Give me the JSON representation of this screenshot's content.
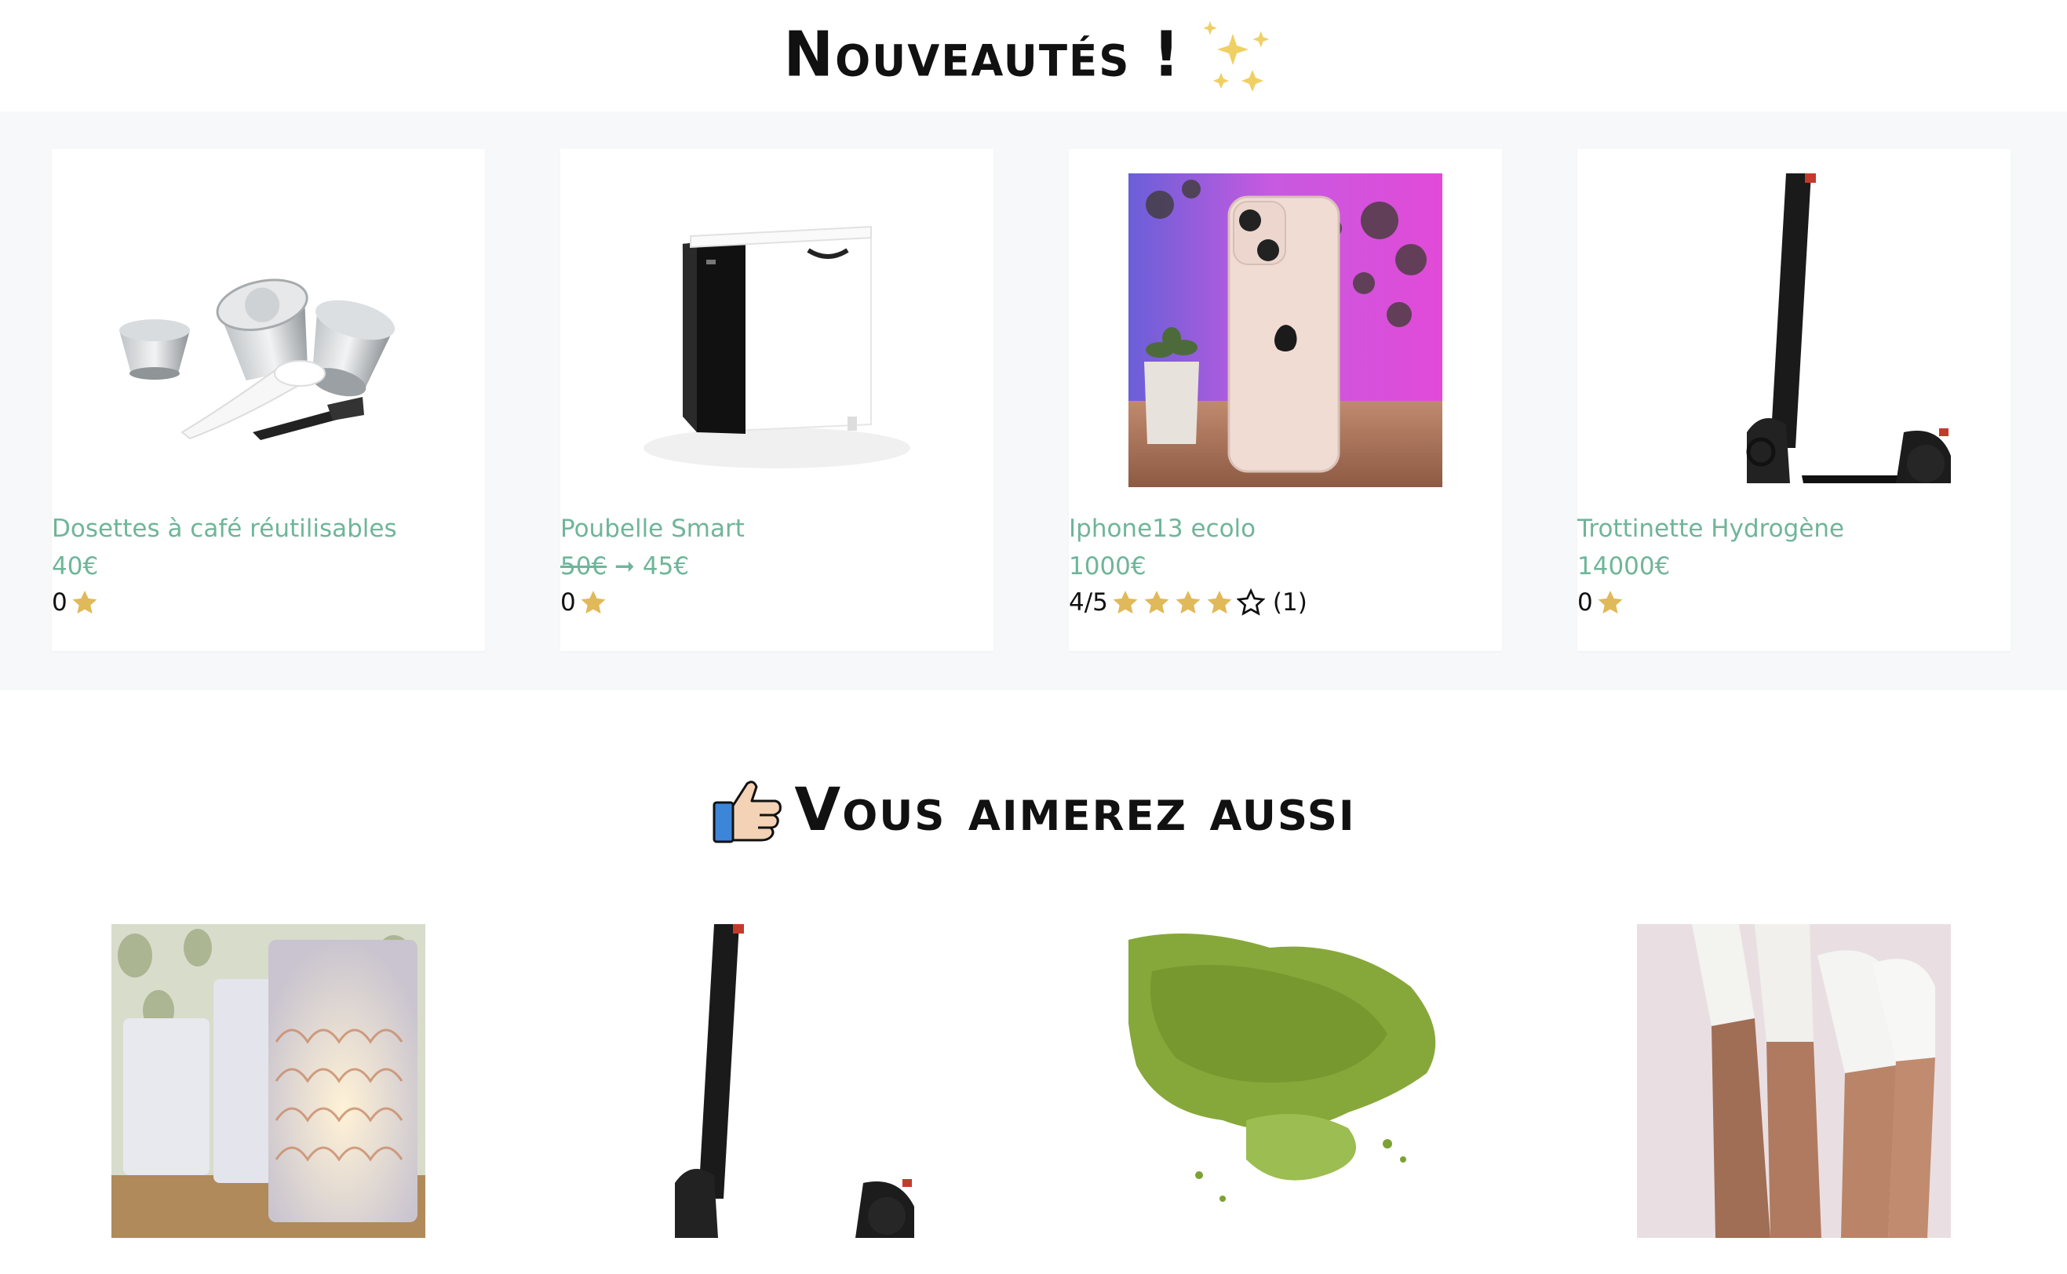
{
  "sections": {
    "new": {
      "title": "Nouveautés !"
    },
    "also": {
      "title": "Vous aimerez aussi"
    }
  },
  "new_products": [
    {
      "name": "Dosettes à café réutilisables",
      "price": "40€",
      "old_price": "",
      "rating_text": "0",
      "stars": 1,
      "filled_stars": 1,
      "review_count": ""
    },
    {
      "name": "Poubelle Smart",
      "price": "45€",
      "old_price": "50€",
      "arrow": "➞",
      "rating_text": "0",
      "stars": 1,
      "filled_stars": 1,
      "review_count": ""
    },
    {
      "name": "Iphone13 ecolo",
      "price": "1000€",
      "old_price": "",
      "rating_text": "4/5",
      "stars": 5,
      "filled_stars": 4,
      "review_count": "(1)"
    },
    {
      "name": "Trottinette Hydrogène",
      "price": "14000€",
      "old_price": "",
      "rating_text": "0",
      "stars": 1,
      "filled_stars": 1,
      "review_count": ""
    }
  ],
  "suggested_products": [
    {
      "icon": "candle-lantern-image"
    },
    {
      "icon": "scooter-image"
    },
    {
      "icon": "matcha-powder-image"
    },
    {
      "icon": "socks-image"
    }
  ],
  "colors": {
    "accent_green": "#6fb59a",
    "star_gold": "#e0b95a",
    "band_bg": "#f7f8f9"
  }
}
